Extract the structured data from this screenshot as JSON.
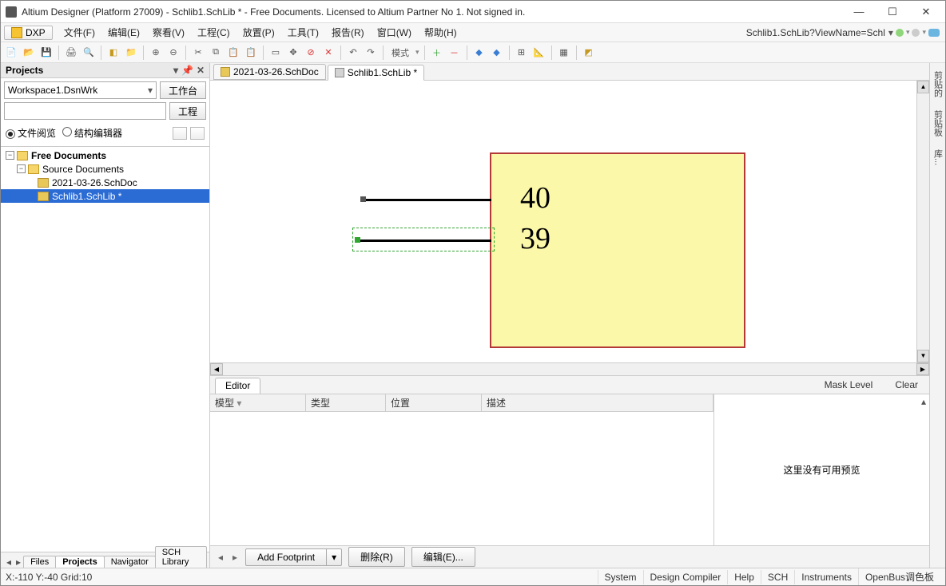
{
  "title": "Altium Designer (Platform 27009) - Schlib1.SchLib * - Free Documents. Licensed to Altium Partner No 1. Not signed in.",
  "dxp": "DXP",
  "menus": {
    "file": "文件(F)",
    "edit": "编辑(E)",
    "view": "察看(V)",
    "project": "工程(C)",
    "place": "放置(P)",
    "tools": "工具(T)",
    "report": "报告(R)",
    "window": "窗口(W)",
    "help": "帮助(H)"
  },
  "crumb": "Schlib1.SchLib?ViewName=Schl",
  "toolbar_mode": "模式",
  "projects": {
    "title": "Projects",
    "workspace": "Workspace1.DsnWrk",
    "btn_workbench": "工作台",
    "btn_project": "工程",
    "radio_file": "文件阅览",
    "radio_struct": "结构编辑器",
    "tree": {
      "root": "Free Documents",
      "src": "Source Documents",
      "doc1": "2021-03-26.SchDoc",
      "doc2": "Schlib1.SchLib *"
    }
  },
  "lefttabs": {
    "files": "Files",
    "projects": "Projects",
    "navigator": "Navigator",
    "schlib": "SCH Library"
  },
  "doctabs": {
    "t1": "2021-03-26.SchDoc",
    "t2": "Schlib1.SchLib *"
  },
  "pins": {
    "p40": "40",
    "p39": "39"
  },
  "editor": {
    "tab": "Editor",
    "mask": "Mask Level",
    "clear": "Clear",
    "col_model": "模型",
    "col_type": "类型",
    "col_loc": "位置",
    "col_desc": "描述",
    "no_preview": "这里没有可用预览",
    "add_fp": "Add Footprint",
    "delete": "删除(R)",
    "edit": "编辑(E)..."
  },
  "status": {
    "coords": "X:-110 Y:-40  Grid:10",
    "system": "System",
    "dc": "Design Compiler",
    "help": "Help",
    "sch": "SCH",
    "instr": "Instruments",
    "openbus": "OpenBus调色板"
  },
  "rdock": {
    "t1": "剪贴的",
    "t2": "剪贴板",
    "t3": "库..."
  }
}
